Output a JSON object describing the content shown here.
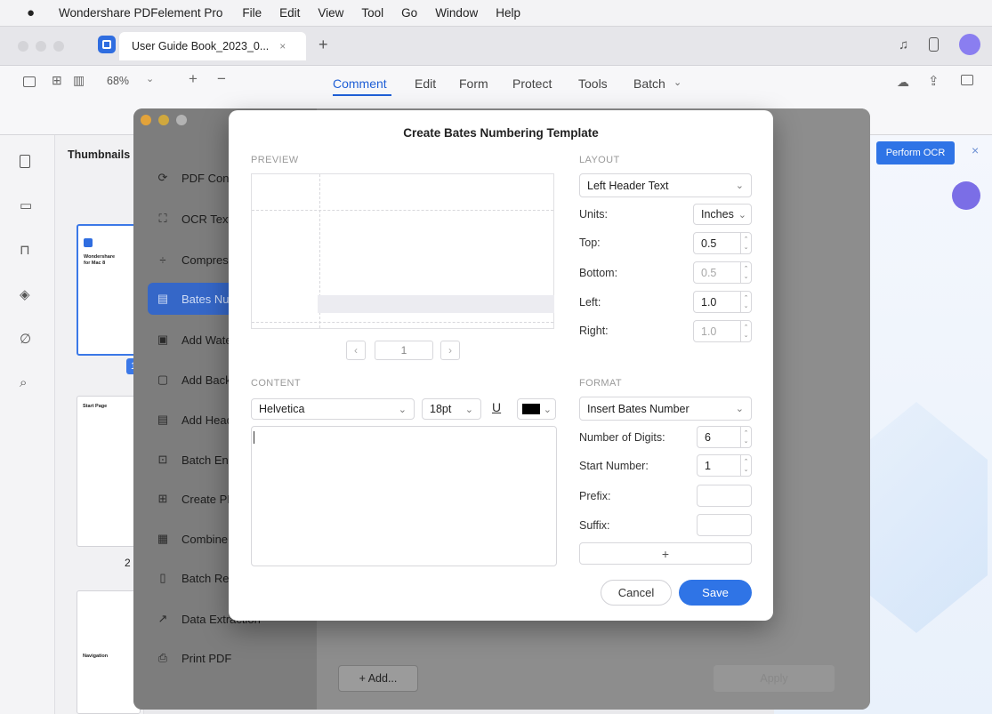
{
  "menubar": {
    "app_name": "Wondershare PDFelement Pro",
    "items": [
      "File",
      "Edit",
      "View",
      "Tool",
      "Go",
      "Window",
      "Help"
    ]
  },
  "tab": {
    "title": "User Guide Book_2023_0...",
    "close": "×",
    "new": "+"
  },
  "toolbar": {
    "zoom": "68%",
    "tabs": [
      "Comment",
      "Edit",
      "Form",
      "Protect",
      "Tools",
      "Batch"
    ],
    "active_tab": "Comment",
    "batch_chevron": "⌄"
  },
  "thumbnails": {
    "title": "Thumbnails",
    "page_badge": "1",
    "page2_label": "2",
    "page1_lines": [
      "Wondershare",
      "for Mac 8"
    ],
    "page2_title": "Start Page",
    "page3_title": "Navigation"
  },
  "right_panel": {
    "ocr_button": "Perform OCR",
    "close": "×"
  },
  "batch": {
    "items": [
      {
        "label": "PDF Converter",
        "icon": "⟳"
      },
      {
        "label": "OCR Text",
        "icon": "⛶"
      },
      {
        "label": "Compress",
        "icon": "÷"
      },
      {
        "label": "Bates Numbering",
        "icon": "▤"
      },
      {
        "label": "Add Watermark",
        "icon": "▣"
      },
      {
        "label": "Add Background",
        "icon": "▢"
      },
      {
        "label": "Add Header & Footer",
        "icon": "▤"
      },
      {
        "label": "Batch Encrypt",
        "icon": "⊡"
      },
      {
        "label": "Create PDF",
        "icon": "⊞"
      },
      {
        "label": "Combine",
        "icon": "▦"
      },
      {
        "label": "Batch Remove",
        "icon": "▯"
      },
      {
        "label": "Data Extraction",
        "icon": "↗"
      },
      {
        "label": "Print PDF",
        "icon": "⎙"
      }
    ],
    "active_index": 3,
    "add_button": "+ Add...",
    "apply_button": "Apply"
  },
  "dialog": {
    "title": "Create Bates Numbering Template",
    "preview_label": "PREVIEW",
    "page_input": "1",
    "content_label": "CONTENT",
    "font": "Helvetica",
    "font_size": "18pt",
    "underline": "U",
    "layout_label": "LAYOUT",
    "layout_position": "Left Header Text",
    "units_label": "Units:",
    "units_value": "Inches",
    "top_label": "Top:",
    "top_value": "0.5",
    "bottom_label": "Bottom:",
    "bottom_value": "0.5",
    "left_label": "Left:",
    "left_value": "1.0",
    "right_label": "Right:",
    "right_value": "1.0",
    "format_label": "FORMAT",
    "format_value": "Insert Bates Number",
    "digits_label": "Number of Digits:",
    "digits_value": "6",
    "start_label": "Start Number:",
    "start_value": "1",
    "prefix_label": "Prefix:",
    "prefix_value": "",
    "suffix_label": "Suffix:",
    "suffix_value": "",
    "add_symbol": "+",
    "cancel": "Cancel",
    "save": "Save",
    "accent": "#2f74e6"
  }
}
